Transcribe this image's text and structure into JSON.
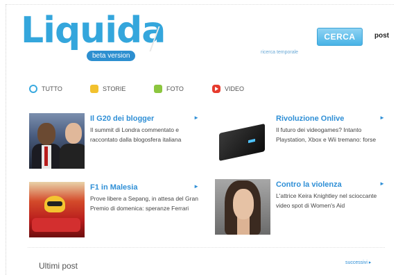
{
  "header": {
    "logo_text": "Liquida",
    "beta_label": "beta version",
    "search_placeholder": "",
    "search_button": "CERCA",
    "scope_label": "post",
    "advanced_link": "ricerca temporale"
  },
  "filters": [
    {
      "label": "TUTTO",
      "icon": "circle-icon",
      "color": "#39a9df"
    },
    {
      "label": "STORIE",
      "icon": "stories-icon",
      "color": "#f2c12e"
    },
    {
      "label": "FOTO",
      "icon": "photo-icon",
      "color": "#8cc63f"
    },
    {
      "label": "VIDEO",
      "icon": "video-play-icon",
      "color": "#e63b2e"
    }
  ],
  "stories": [
    {
      "title": "Il G20 dei blogger",
      "description": "Il summit di Londra commentato e raccontato dalla blogosfera italiana"
    },
    {
      "title": "Rivoluzione Onlive",
      "description": "Il futuro dei videogames? Intanto Playstation, Xbox e Wii tremano: forse"
    },
    {
      "title": "F1 in Malesia",
      "description": "Prove libere a Sepang, in attesa del Gran Premio di domenica: speranze Ferrari"
    },
    {
      "title": "Contro la violenza",
      "description": "L'attrice Keira Knightley nel scioccante video spot di Women's Aid"
    }
  ],
  "footer": {
    "section_title": "Ultimi post",
    "next_link": "successivi ▸"
  },
  "colors": {
    "brand": "#34a6dc",
    "link": "#2f8fd6",
    "button": "#48b3e6"
  }
}
